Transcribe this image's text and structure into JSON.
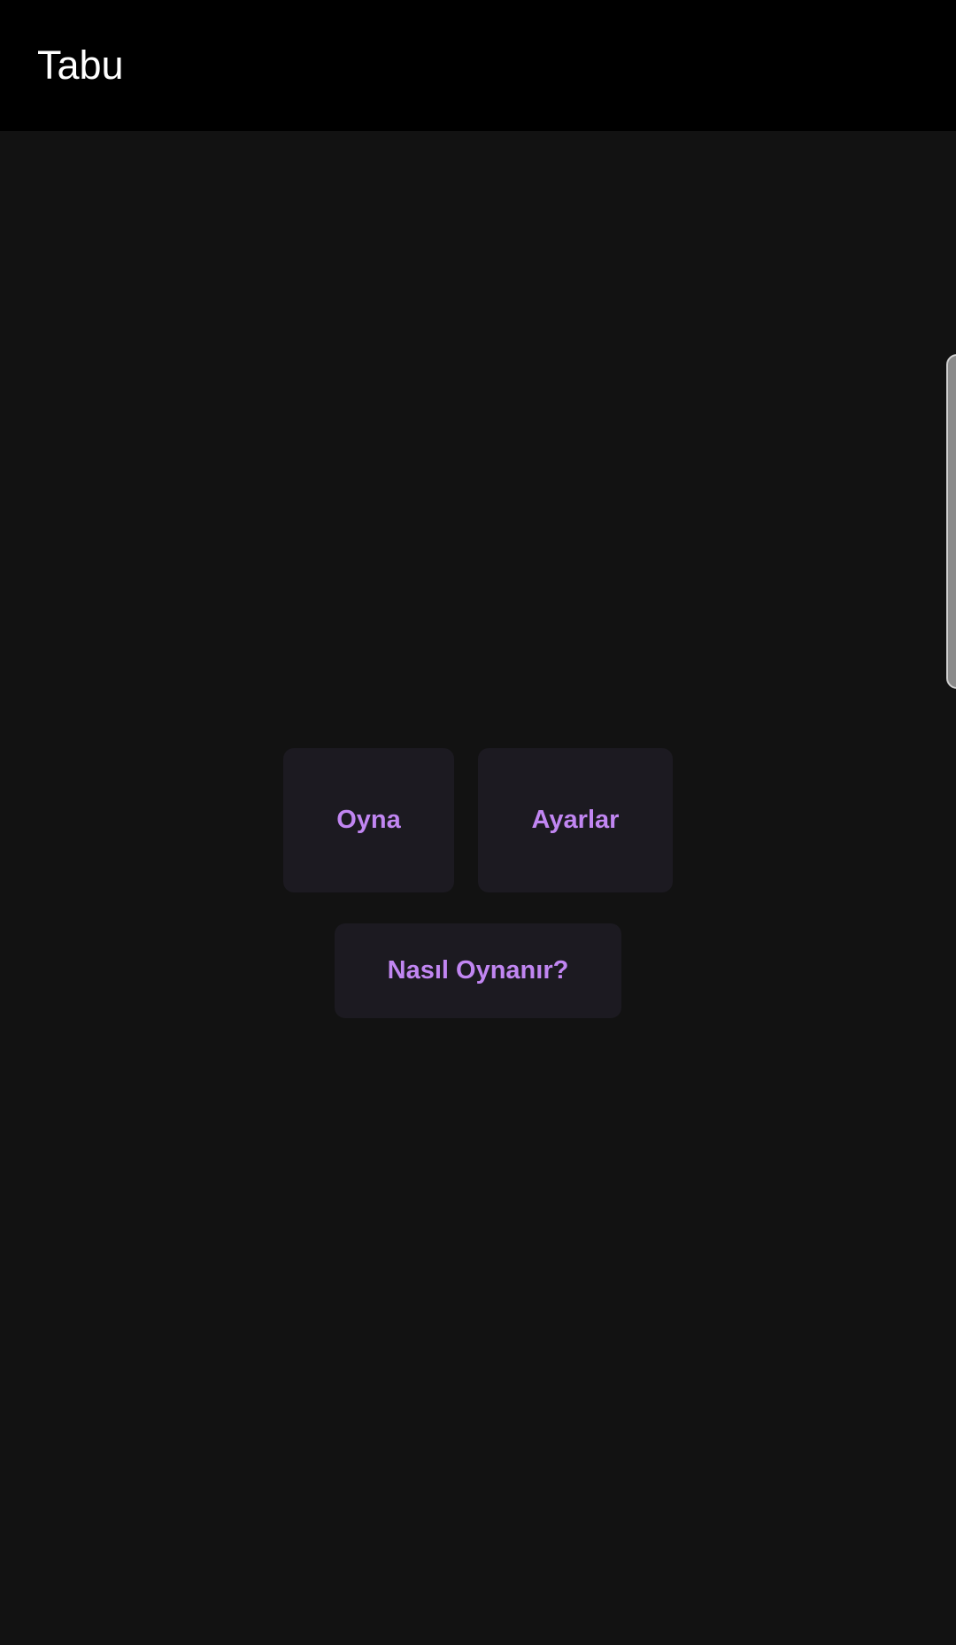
{
  "app_bar": {
    "title": "Tabu"
  },
  "menu": {
    "play_label": "Oyna",
    "settings_label": "Ayarlar",
    "how_to_play_label": "Nasıl Oynanır?"
  },
  "colors": {
    "app_bar_bg": "#000000",
    "page_bg": "#121212",
    "button_bg": "#1c1a21",
    "button_text": "#c186f2"
  }
}
